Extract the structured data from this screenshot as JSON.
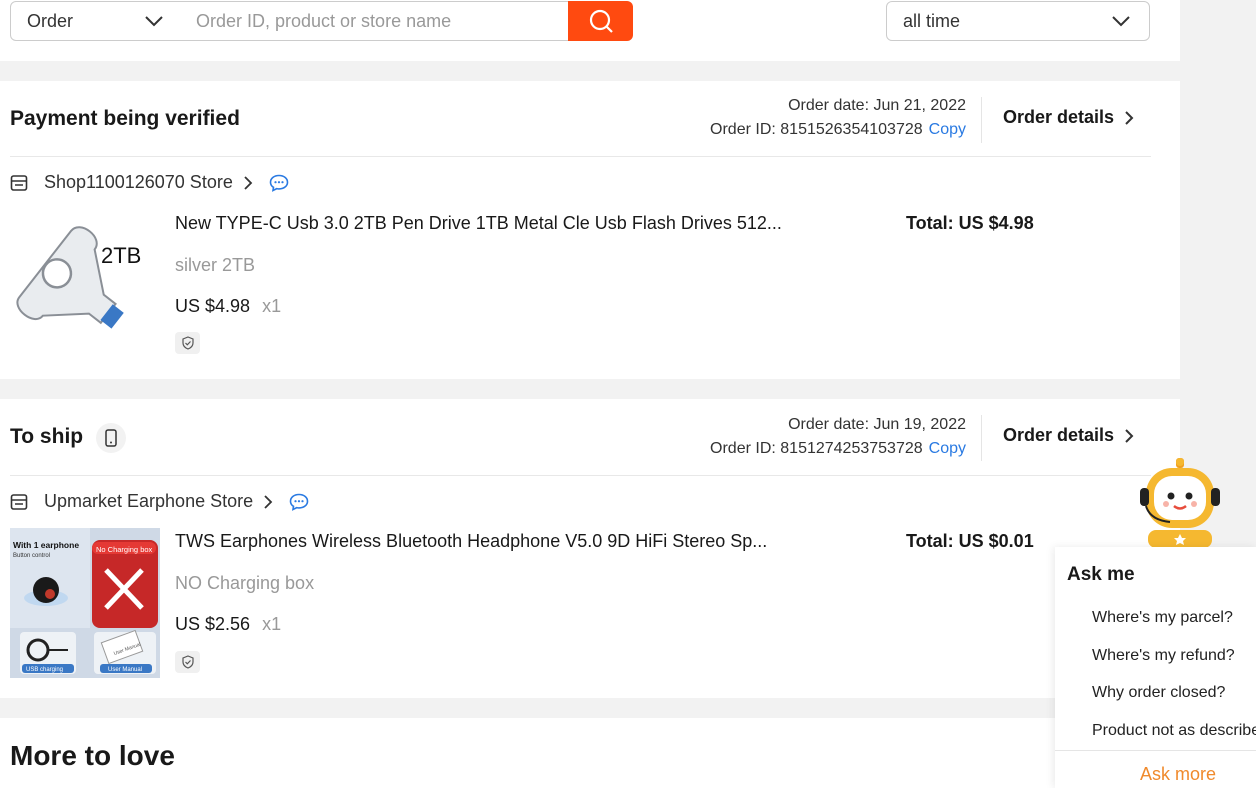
{
  "filter": {
    "type_selected": "Order",
    "search_placeholder": "Order ID, product or store name",
    "time_selected": "all time"
  },
  "orders": [
    {
      "status": "Payment being verified",
      "order_date": "Order date: Jun 21, 2022",
      "order_id_label": "Order ID: 8151526354103728",
      "copy_label": "Copy",
      "details_label": "Order details",
      "store": "Shop1100126070 Store",
      "product_title": "New TYPE-C Usb 3.0 2TB Pen Drive 1TB Metal Cle Usb Flash Drives 512...",
      "variant": "silver 2TB",
      "price": "US $4.98",
      "qty": "x1",
      "total": "Total: US $4.98",
      "thumb_label": "2TB"
    },
    {
      "status": "To ship",
      "order_date": "Order date: Jun 19, 2022",
      "order_id_label": "Order ID: 8151274253753728",
      "copy_label": "Copy",
      "details_label": "Order details",
      "store": "Upmarket Earphone Store",
      "product_title": "TWS Earphones Wireless Bluetooth Headphone V5.0 9D HiFi Stereo Sp...",
      "variant": "NO Charging box",
      "price": "US $2.56",
      "qty": "x1",
      "total": "Total: US $0.01",
      "thumb_texts": {
        "with": "With 1 earphone",
        "button": "Button control",
        "nobox": "No Charging box",
        "usb": "USB charging",
        "manual": "User Manual",
        "manual_card": "User Manual"
      }
    }
  ],
  "more_to_love": "More to love",
  "ask": {
    "title": "Ask me",
    "questions": [
      "Where's my parcel?",
      "Where's my refund?",
      "Why order closed?",
      "Product not as described"
    ],
    "more_label": "Ask more"
  },
  "colors": {
    "accent": "#ff4a10",
    "link": "#2a7ae2",
    "ask_more": "#f08a2c"
  },
  "icons": [
    "chevron-down-icon",
    "search-icon",
    "store-icon",
    "chevron-right-icon",
    "chat-icon",
    "shield-icon",
    "phone-icon",
    "assistant-robot-icon"
  ]
}
